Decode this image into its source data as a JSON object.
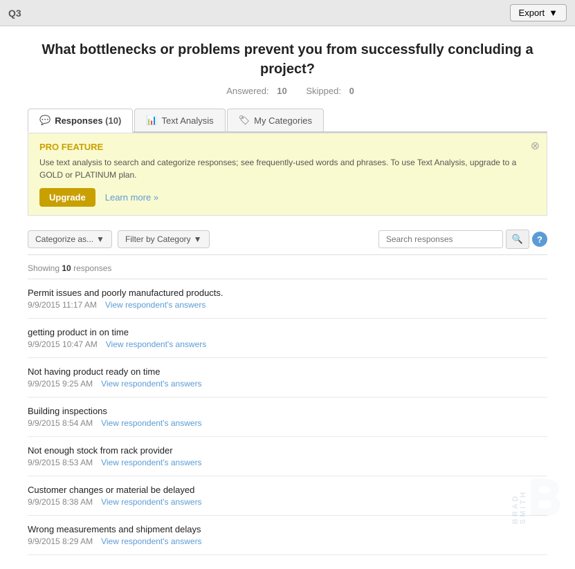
{
  "header": {
    "question_number": "Q3",
    "export_label": "Export",
    "export_arrow": "▼"
  },
  "question": {
    "title": "What bottlenecks or problems prevent you from successfully concluding a project?",
    "answered_label": "Answered:",
    "answered_count": "10",
    "skipped_label": "Skipped:",
    "skipped_count": "0"
  },
  "tabs": [
    {
      "id": "responses",
      "label": "Responses",
      "count": "(10)",
      "icon": "💬",
      "active": true
    },
    {
      "id": "text-analysis",
      "label": "Text Analysis",
      "count": "",
      "icon": "📊",
      "active": false
    },
    {
      "id": "my-categories",
      "label": "My Categories",
      "count": "",
      "icon": "🏷",
      "active": false
    }
  ],
  "pro_banner": {
    "title": "PRO FEATURE",
    "text": "Use text analysis to search and categorize responses; see frequently-used words and phrases. To use Text Analysis, upgrade to a GOLD or PLATINUM plan.",
    "upgrade_label": "Upgrade",
    "learn_more_label": "Learn more »",
    "close_label": "⊗"
  },
  "toolbar": {
    "categorize_label": "Categorize as...",
    "filter_label": "Filter by Category",
    "search_placeholder": "Search responses",
    "search_icon": "🔍",
    "help_icon": "?"
  },
  "showing": {
    "prefix": "Showing ",
    "count": "10",
    "suffix": " responses"
  },
  "responses": [
    {
      "text": "Permit issues and poorly manufactured products.",
      "date": "9/9/2015 11:17 AM",
      "view_link": "View respondent's answers"
    },
    {
      "text": "getting product in on time",
      "date": "9/9/2015 10:47 AM",
      "view_link": "View respondent's answers"
    },
    {
      "text": "Not having product ready on time",
      "date": "9/9/2015 9:25 AM",
      "view_link": "View respondent's answers"
    },
    {
      "text": "Building inspections",
      "date": "9/9/2015 8:54 AM",
      "view_link": "View respondent's answers"
    },
    {
      "text": "Not enough stock from rack provider",
      "date": "9/9/2015 8:53 AM",
      "view_link": "View respondent's answers"
    },
    {
      "text": "Customer changes or material be delayed",
      "date": "9/9/2015 8:38 AM",
      "view_link": "View respondent's answers"
    },
    {
      "text": "Wrong measurements and shipment delays",
      "date": "9/9/2015 8:29 AM",
      "view_link": "View respondent's answers"
    }
  ]
}
